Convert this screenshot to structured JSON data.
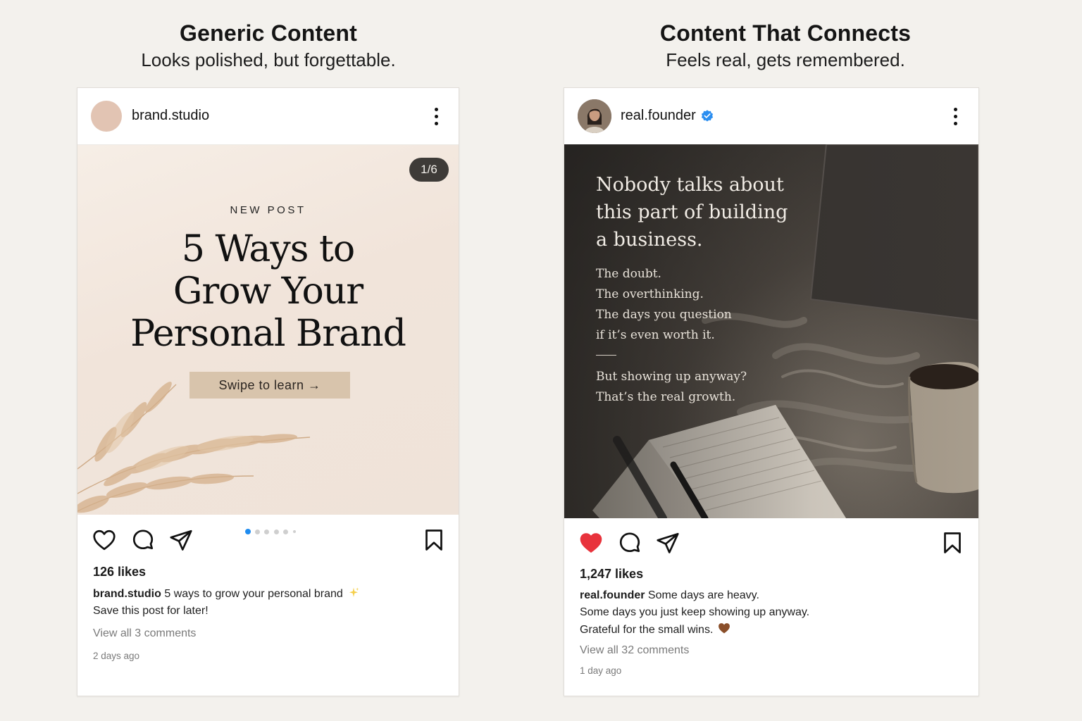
{
  "left_column": {
    "title": "Generic Content",
    "subtitle": "Looks polished, but forgettable."
  },
  "right_column": {
    "title": "Content That Connects",
    "subtitle": "Feels real, gets remembered."
  },
  "left_post": {
    "username": "brand.studio",
    "slide_counter": "1/6",
    "kicker": "NEW POST",
    "headline_lines": [
      "5 Ways to",
      "Grow Your",
      "Personal Brand"
    ],
    "cta_label": "Swipe to learn →",
    "carousel": {
      "total": 6,
      "active": 0
    },
    "liked": false,
    "likes": "126 likes",
    "caption_user": "brand.studio",
    "caption_line1": "5 ways to grow your personal brand",
    "caption_emoji_icon": "sparkles-icon",
    "caption_line2": "Save this post for later!",
    "view_comments": "View all 3 comments",
    "time_ago": "2 days ago",
    "colors": {
      "avatar": "#e2c4b3",
      "cta_bg": "#d8c4ac",
      "active_dot": "#1f8cf0"
    }
  },
  "right_post": {
    "username": "real.founder",
    "verified": true,
    "quote_title_lines": [
      "Nobody talks about",
      "this part of building",
      "a business."
    ],
    "quote_lines": [
      "The doubt.",
      "The overthinking.",
      "The days you question",
      "if it’s even worth it."
    ],
    "quote_close_lines": [
      "But showing up anyway?",
      "That’s the real growth."
    ],
    "liked": true,
    "likes": "1,247 likes",
    "caption_user": "real.founder",
    "caption_line1": "Some days are heavy.",
    "caption_line2": "Some days you just keep showing up anyway.",
    "caption_line3": "Grateful for the small wins.",
    "caption_emoji_icon": "brown-heart-icon",
    "view_comments": "View all 32 comments",
    "time_ago": "1 day ago",
    "colors": {
      "like_red": "#e8333c",
      "verified_blue": "#2b8ef0"
    }
  }
}
